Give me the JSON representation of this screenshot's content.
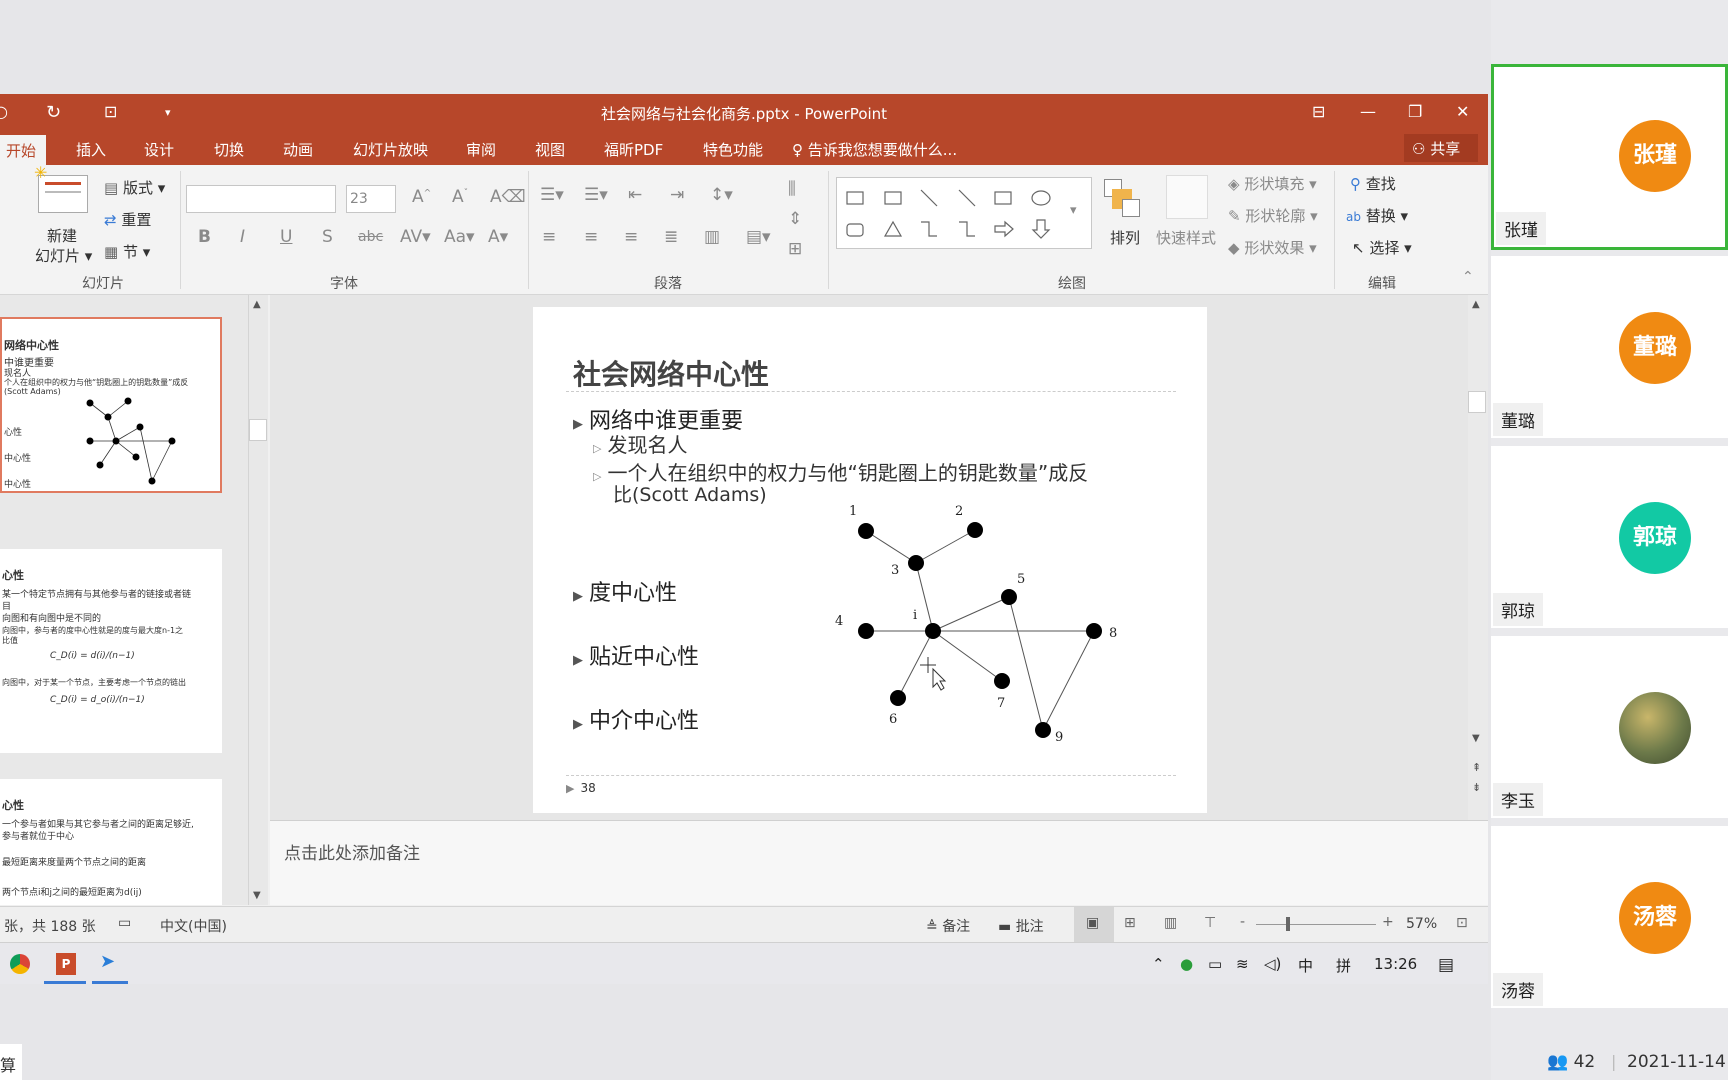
{
  "window": {
    "title": "社会网络与社会化商务.pptx - PowerPoint"
  },
  "tabs": [
    "开始",
    "插入",
    "设计",
    "切换",
    "动画",
    "幻灯片放映",
    "审阅",
    "视图",
    "福昕PDF",
    "特色功能"
  ],
  "tell_me": "告诉我您想要做什么...",
  "share": "共享",
  "ribbon": {
    "slides_group": {
      "label": "幻灯片",
      "new_slide_1": "新建",
      "new_slide_2": "幻灯片",
      "layout": "版式",
      "reset": "重置",
      "section": "节"
    },
    "font_group": {
      "label": "字体",
      "size": "23"
    },
    "paragraph_group": {
      "label": "段落"
    },
    "drawing_group": {
      "label": "绘图",
      "arrange": "排列",
      "quick_styles": "快速样式",
      "shape_fill": "形状填充",
      "shape_outline": "形状轮廓",
      "shape_effects": "形状效果"
    },
    "editing_group": {
      "label": "编辑",
      "find": "查找",
      "replace": "替换",
      "select": "选择"
    }
  },
  "thumbnails": [
    {
      "title": "网络中心性",
      "lines": [
        "中谁更重要",
        "现名人",
        "个人在组织中的权力与他“钥匙圈上的钥匙数量”成反",
        "(Scott Adams)",
        "心性",
        "中心性",
        "中心性"
      ]
    },
    {
      "title": "心性",
      "lines": [
        "某一个特定节点拥有与其他参与者的链接或者链",
        "目",
        "向图和有向图中是不同的",
        "向图中，参与者的度中心性就是的度与最大度n-1之",
        "比值",
        "C_D(i) = d(i)/(n−1)",
        "向图中，对于某一个节点，主要考虑一个节点的链出",
        "C_D(i) = d_o(i)/(n−1)"
      ]
    },
    {
      "title": "心性",
      "lines": [
        "一个参与者如果与其它参与者之间的距离足够近,",
        "参与者就位于中心",
        "最短距离来度量两个节点之间的距离",
        "两个节点i和j之间的最短距离为d(ij)"
      ]
    }
  ],
  "slide": {
    "title": "社会网络中心性",
    "bullets": [
      {
        "level": 1,
        "text": "网络中谁更重要"
      },
      {
        "level": 2,
        "text": "发现名人"
      },
      {
        "level": 2,
        "text": "一个人在组织中的权力与他“钥匙圈上的钥匙数量”成反"
      },
      {
        "level": 2,
        "text": "比(Scott Adams)"
      },
      {
        "level": 1,
        "text": "度中心性"
      },
      {
        "level": 1,
        "text": "贴近中心性"
      },
      {
        "level": 1,
        "text": "中介中心性"
      }
    ],
    "graph_labels": [
      "1",
      "2",
      "3",
      "4",
      "i",
      "5",
      "8",
      "6",
      "7",
      "9"
    ],
    "page_number": "38"
  },
  "notes": {
    "placeholder": "点击此处添加备注"
  },
  "status": {
    "slide_info": "张，共 188 张",
    "language": "中文(中国)",
    "notes_btn": "备注",
    "comments_btn": "批注",
    "zoom": "57%"
  },
  "taskbar": {
    "ime_1": "中",
    "ime_2": "拼",
    "time": "13:26"
  },
  "participants": [
    {
      "name": "张瑾",
      "avatar_text": "张瑾",
      "color": "#f08a12",
      "active": true
    },
    {
      "name": "董璐",
      "avatar_text": "董璐",
      "color": "#f08a12",
      "active": false
    },
    {
      "name": "郭琼",
      "avatar_text": "郭琼",
      "color": "#12c9a4",
      "active": false
    },
    {
      "name": "李玉",
      "avatar_text": "",
      "color": "#7a8a5a",
      "active": false
    },
    {
      "name": "汤蓉",
      "avatar_text": "汤蓉",
      "color": "#f08a12",
      "active": false
    }
  ],
  "meeting": {
    "count": "42",
    "date": "2021-11-14"
  },
  "bottom_left": "算"
}
